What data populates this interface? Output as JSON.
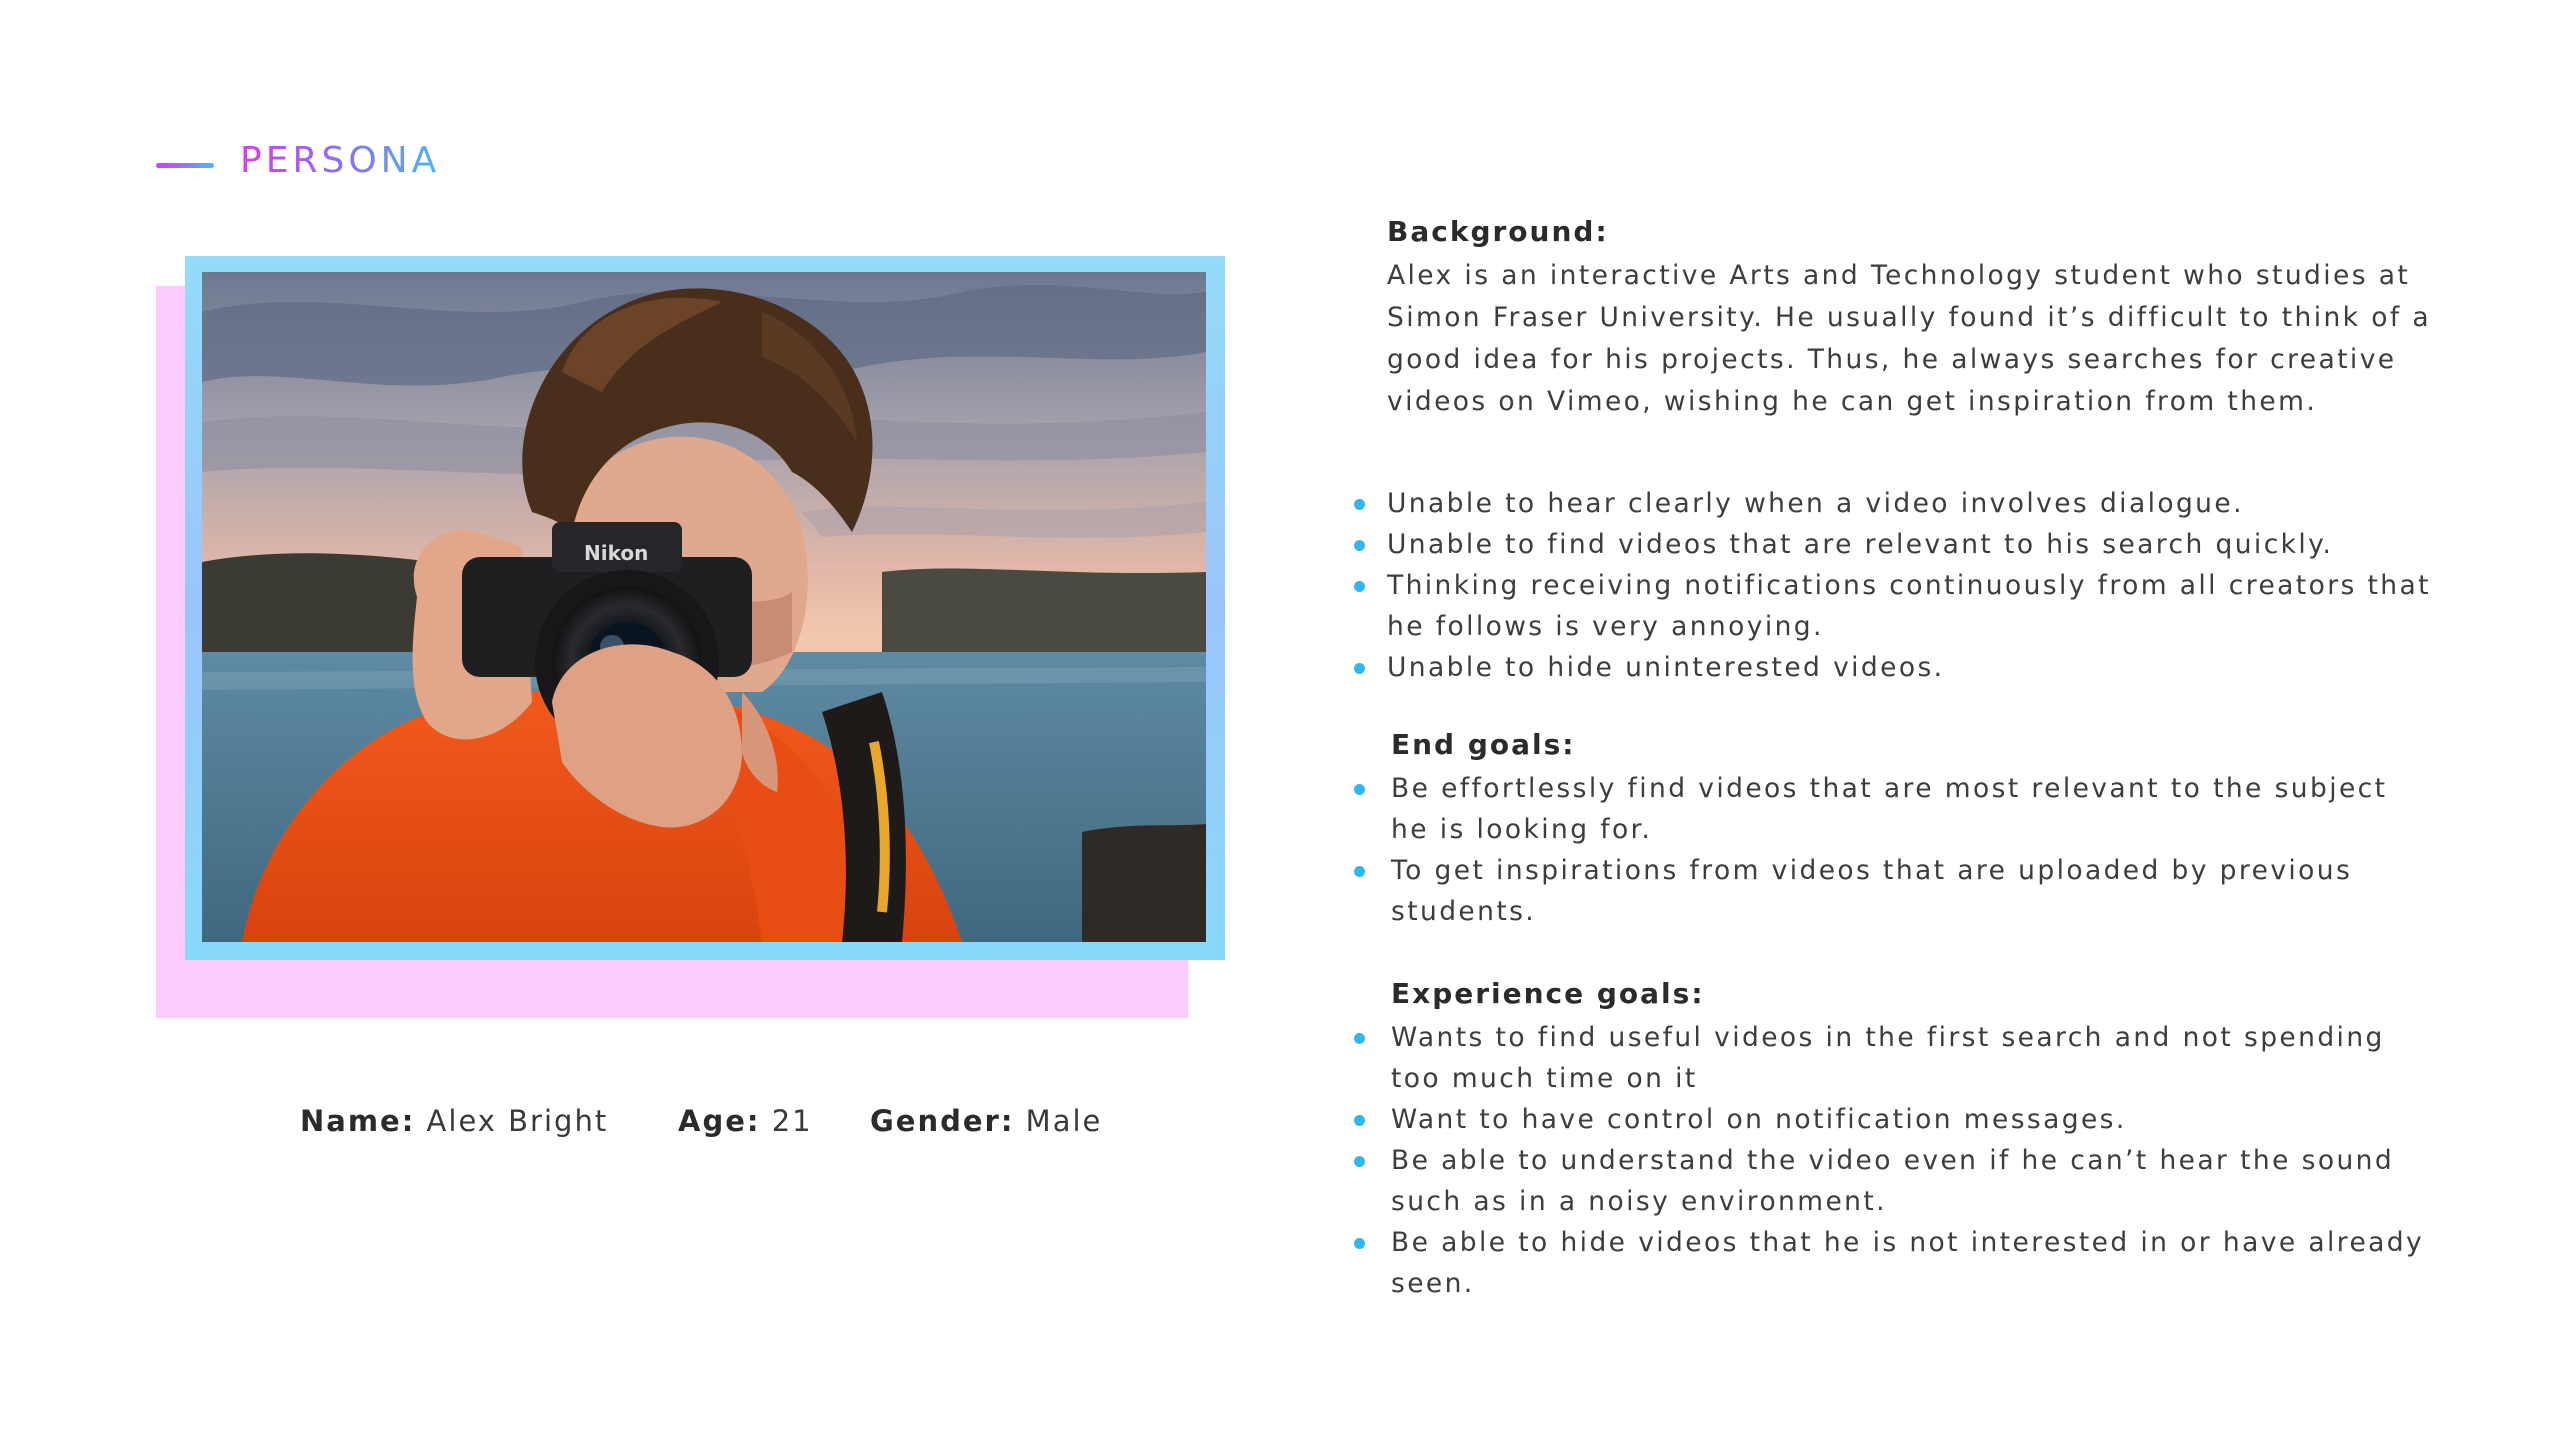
{
  "header": {
    "title": "PERSONA"
  },
  "persona": {
    "name_label": "Name:",
    "name_value": "Alex Bright",
    "age_label": "Age:",
    "age_value": "21",
    "gender_label": "Gender:",
    "gender_value": "Male",
    "photo_icon": "photographer-with-camera-photo",
    "camera_brand": "Nikon"
  },
  "background": {
    "title": "Background:",
    "lines": [
      "Alex is an interactive Arts and Technology student who studies at",
      "Simon Fraser University. He usually found it’s difficult to think of a",
      "good idea for his projects. Thus, he always searches for creative",
      "videos on Vimeo, wishing he can get inspiration from them."
    ]
  },
  "pain_points": [
    [
      "Unable to hear clearly when a video involves dialogue."
    ],
    [
      "Unable to find videos that are relevant to his search quickly."
    ],
    [
      "Thinking receiving notifications continuously from all creators that",
      "he follows is very annoying."
    ],
    [
      "Unable to hide uninterested videos."
    ]
  ],
  "end_goals": {
    "title": "End goals:",
    "items": [
      [
        "Be effortlessly find videos that are most relevant to the subject",
        "he is looking for."
      ],
      [
        "To get inspirations from videos that are uploaded by previous",
        "students."
      ]
    ]
  },
  "experience_goals": {
    "title": "Experience goals:",
    "items": [
      [
        "Wants to find useful videos in the first search and not spending",
        "too much time on it"
      ],
      [
        "Want to have control on notification messages."
      ],
      [
        "Be able to understand the video even if he can’t hear the sound",
        "such as in a noisy environment."
      ],
      [
        "Be able to hide videos that he is not interested in or have already",
        "seen."
      ]
    ]
  },
  "colors": {
    "accent_pink": "#d63cf0",
    "accent_blue": "#4fb6f2",
    "bullet": "#2fb8ec",
    "shadow_pink": "#fdcbfd",
    "frame_blue": "#93dcfb"
  }
}
